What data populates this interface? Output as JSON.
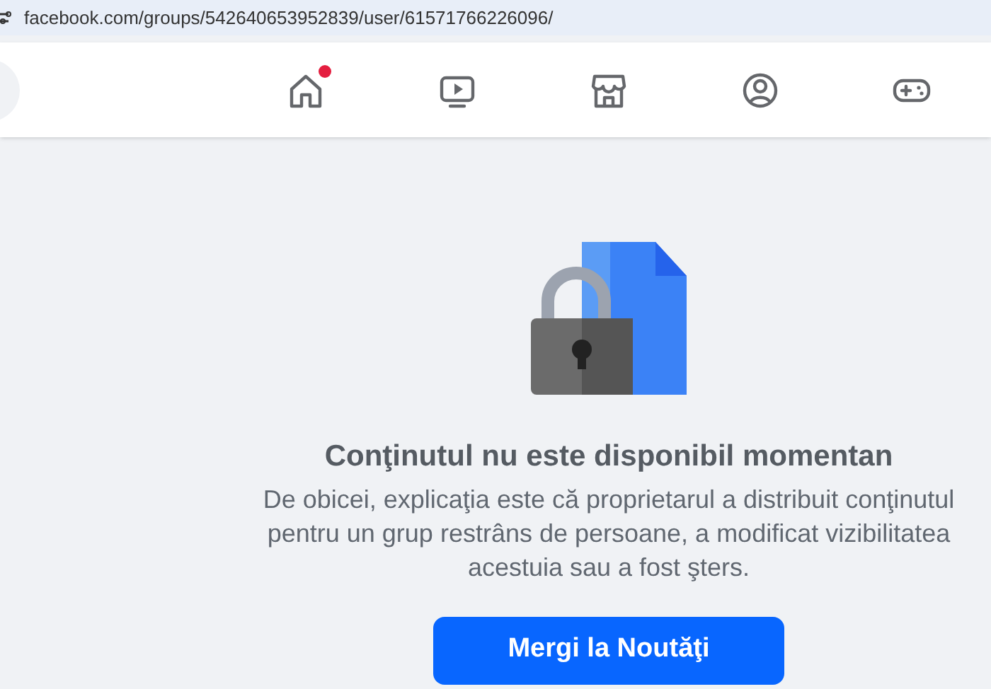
{
  "address_bar": {
    "url": "facebook.com/groups/542640653952839/user/61571766226096/"
  },
  "nav": {
    "tabs": [
      {
        "kind": "home",
        "badge": true
      },
      {
        "kind": "video",
        "badge": false
      },
      {
        "kind": "marketplace",
        "badge": false
      },
      {
        "kind": "groups",
        "badge": false
      },
      {
        "kind": "gaming",
        "badge": false
      }
    ]
  },
  "message": {
    "title": "Conţinutul nu este disponibil momentan",
    "body": "De obicei, explicaţia este că proprietarul a distribuit conţinutul pentru un grup restrâns de persoane, a modificat vizibilitatea acestuia sau a fost şters.",
    "button": "Mergi la Noutăţi"
  }
}
